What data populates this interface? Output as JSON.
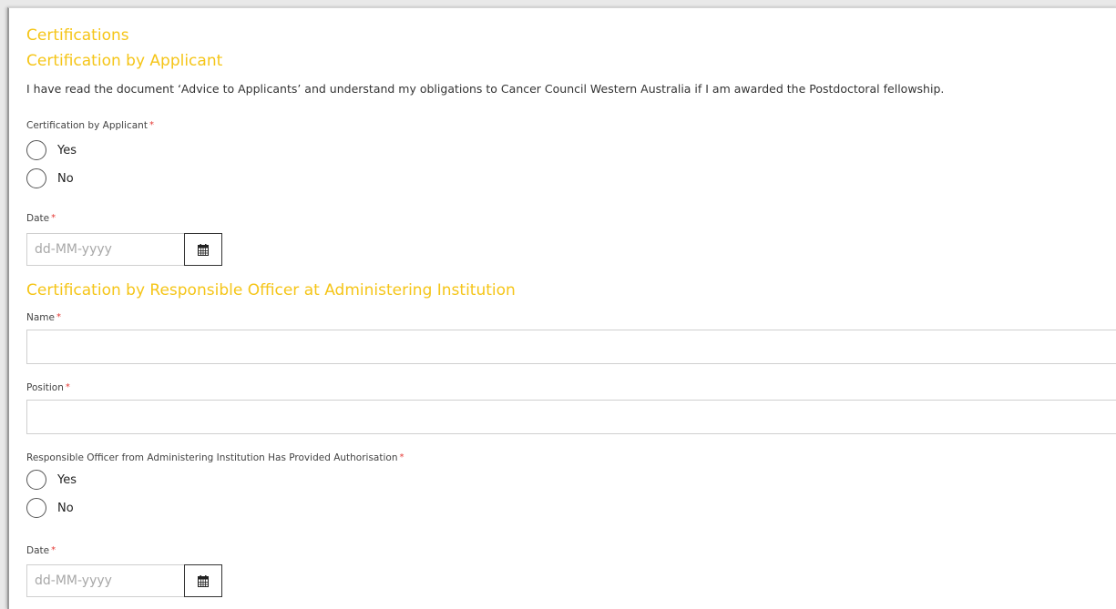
{
  "section1": {
    "title": "Certifications",
    "subtitle": "Certification by Applicant",
    "statement": "I have read the document ‘Advice to Applicants’ and understand my obligations to Cancer Council Western Australia if I am awarded the Postdoctoral fellowship.",
    "applicant_certification": {
      "label": "Certification by Applicant",
      "required": "*",
      "options": [
        "Yes",
        "No"
      ]
    },
    "date": {
      "label": "Date",
      "required": "*",
      "placeholder": "dd-MM-yyyy",
      "icon": "calendar-icon"
    }
  },
  "section2": {
    "title": "Certification by Responsible Officer at Administering Institution",
    "name_field": {
      "label": "Name",
      "required": "*",
      "value": ""
    },
    "position_field": {
      "label": "Position",
      "required": "*",
      "value": ""
    },
    "authorisation": {
      "label": "Responsible Officer from Administering Institution Has Provided Authorisation",
      "required": "*",
      "options": [
        "Yes",
        "No"
      ]
    },
    "date": {
      "label": "Date",
      "required": "*",
      "placeholder": "dd-MM-yyyy",
      "icon": "calendar-icon"
    }
  },
  "colors": {
    "heading": "#f5c518",
    "required": "#e53935",
    "border": "#cfcfcf"
  }
}
